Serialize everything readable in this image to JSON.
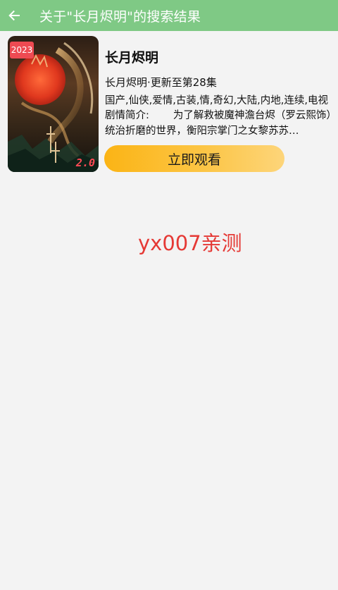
{
  "header": {
    "title": "关于\"长月烬明\"的搜索结果",
    "back_icon": "arrow-left-icon",
    "background_color": "#7fc985"
  },
  "result": {
    "year_badge": "2023",
    "poster_corner_text": "2.0",
    "title": "长月烬明",
    "update": "长月烬明·更新至第28集",
    "tags": "国产,仙侠,爱情,古装,情,奇幻,大陆,内地,连续,电视",
    "synopsis_label": "剧情简介:",
    "synopsis": "为了解救被魔神澹台烬（罗云熙饰）统治折磨的世界，衡阳宗掌门之女黎苏苏…",
    "watch_button": "立即观看",
    "button_color": "#fbb415"
  },
  "watermark": {
    "text": "yx007亲测",
    "color": "#e53935"
  }
}
